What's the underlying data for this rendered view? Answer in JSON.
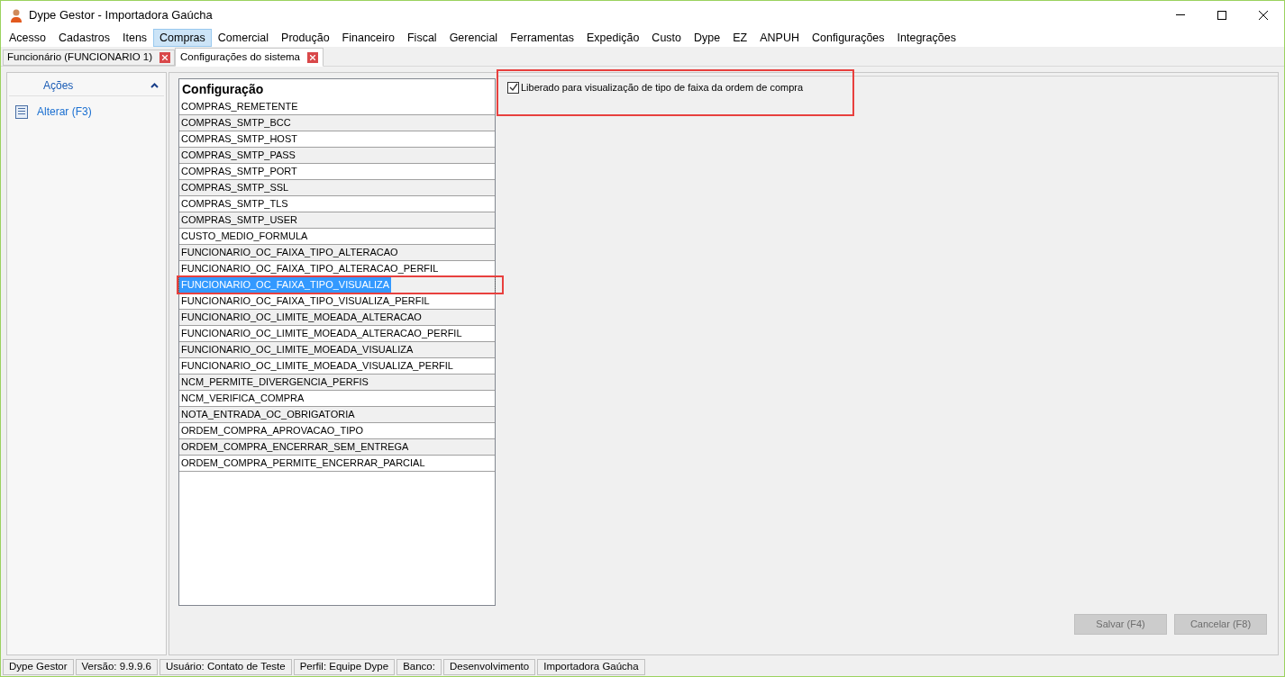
{
  "window": {
    "title": "Dype Gestor - Importadora Gaúcha"
  },
  "menu": [
    {
      "label": "Acesso",
      "selected": false
    },
    {
      "label": "Cadastros",
      "selected": false
    },
    {
      "label": "Itens",
      "selected": false
    },
    {
      "label": "Compras",
      "selected": true
    },
    {
      "label": "Comercial",
      "selected": false
    },
    {
      "label": "Produção",
      "selected": false
    },
    {
      "label": "Financeiro",
      "selected": false
    },
    {
      "label": "Fiscal",
      "selected": false
    },
    {
      "label": "Gerencial",
      "selected": false
    },
    {
      "label": "Ferramentas",
      "selected": false
    },
    {
      "label": "Expedição",
      "selected": false
    },
    {
      "label": "Custo",
      "selected": false
    },
    {
      "label": "Dype",
      "selected": false
    },
    {
      "label": "EZ",
      "selected": false
    },
    {
      "label": "ANPUH",
      "selected": false
    },
    {
      "label": "Configurações",
      "selected": false
    },
    {
      "label": "Integrações",
      "selected": false
    }
  ],
  "tabs": [
    {
      "label": "Funcionário (FUNCIONARIO 1)",
      "selected": false
    },
    {
      "label": "Configurações do sistema",
      "selected": true
    }
  ],
  "sidebar": {
    "title": "Ações",
    "items": [
      {
        "label": "Alterar (F3)"
      }
    ]
  },
  "table": {
    "columns": [
      "Configuração"
    ],
    "rows": [
      {
        "name": "COMPRAS_REMETENTE",
        "selected": false
      },
      {
        "name": "COMPRAS_SMTP_BCC",
        "selected": false
      },
      {
        "name": "COMPRAS_SMTP_HOST",
        "selected": false
      },
      {
        "name": "COMPRAS_SMTP_PASS",
        "selected": false
      },
      {
        "name": "COMPRAS_SMTP_PORT",
        "selected": false
      },
      {
        "name": "COMPRAS_SMTP_SSL",
        "selected": false
      },
      {
        "name": "COMPRAS_SMTP_TLS",
        "selected": false
      },
      {
        "name": "COMPRAS_SMTP_USER",
        "selected": false
      },
      {
        "name": "CUSTO_MEDIO_FORMULA",
        "selected": false
      },
      {
        "name": "FUNCIONARIO_OC_FAIXA_TIPO_ALTERACAO",
        "selected": false
      },
      {
        "name": "FUNCIONARIO_OC_FAIXA_TIPO_ALTERACAO_PERFIL",
        "selected": false
      },
      {
        "name": "FUNCIONARIO_OC_FAIXA_TIPO_VISUALIZA",
        "selected": true
      },
      {
        "name": "FUNCIONARIO_OC_FAIXA_TIPO_VISUALIZA_PERFIL",
        "selected": false
      },
      {
        "name": "FUNCIONARIO_OC_LIMITE_MOEADA_ALTERACAO",
        "selected": false
      },
      {
        "name": "FUNCIONARIO_OC_LIMITE_MOEADA_ALTERACAO_PERFIL",
        "selected": false
      },
      {
        "name": "FUNCIONARIO_OC_LIMITE_MOEADA_VISUALIZA",
        "selected": false
      },
      {
        "name": "FUNCIONARIO_OC_LIMITE_MOEADA_VISUALIZA_PERFIL",
        "selected": false
      },
      {
        "name": "NCM_PERMITE_DIVERGENCIA_PERFIS",
        "selected": false
      },
      {
        "name": "NCM_VERIFICA_COMPRA",
        "selected": false
      },
      {
        "name": "NOTA_ENTRADA_OC_OBRIGATORIA",
        "selected": false
      },
      {
        "name": "ORDEM_COMPRA_APROVACAO_TIPO",
        "selected": false
      },
      {
        "name": "ORDEM_COMPRA_ENCERRAR_SEM_ENTREGA",
        "selected": false
      },
      {
        "name": "ORDEM_COMPRA_PERMITE_ENCERRAR_PARCIAL",
        "selected": false
      }
    ]
  },
  "setting": {
    "label": "Liberado para visualização de tipo de faixa da ordem de compra",
    "checked": true
  },
  "buttons": [
    {
      "label": "Salvar (F4)",
      "disabled": true
    },
    {
      "label": "Cancelar (F8)",
      "disabled": true
    }
  ],
  "status_bar": [
    "Dype Gestor",
    "Versão: 9.9.9.6",
    "Usuário: Contato de Teste",
    "Perfil: Equipe Dype",
    "Banco:",
    "Desenvolvimento",
    "Importadora Gaúcha"
  ]
}
